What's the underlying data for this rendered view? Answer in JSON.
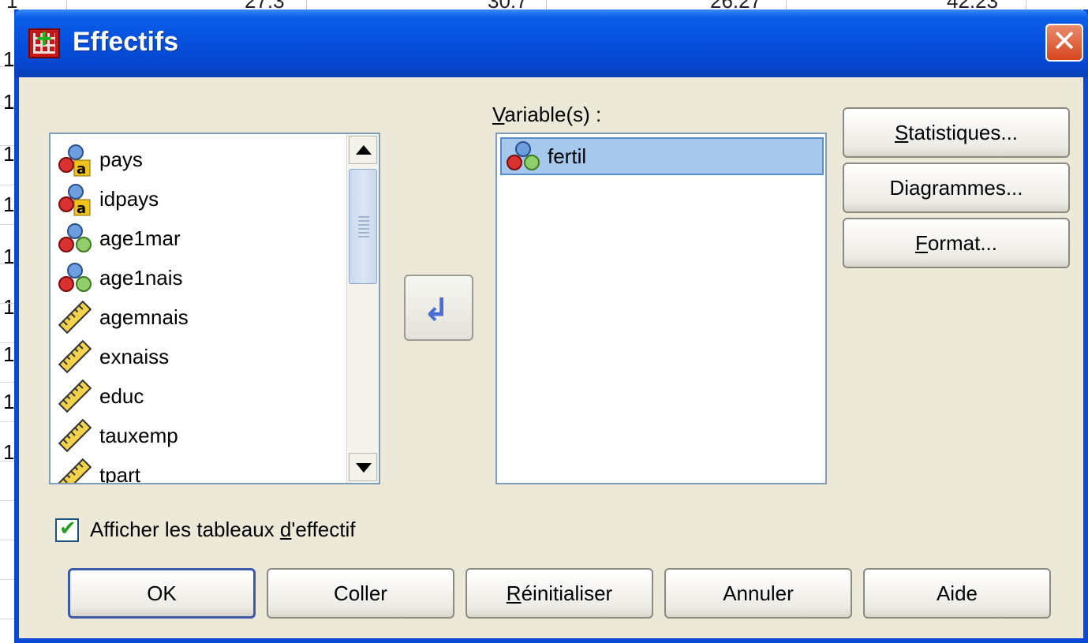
{
  "background": {
    "top_fragments": [
      "27.3",
      "30.7",
      "26.27",
      "42.23"
    ],
    "row_char": "1"
  },
  "dialog": {
    "title": "Effectifs",
    "close_glyph": "✕"
  },
  "source_list": {
    "items": [
      {
        "label": "pays",
        "icon": "nominal-string-icon"
      },
      {
        "label": "idpays",
        "icon": "nominal-string-icon"
      },
      {
        "label": "age1mar",
        "icon": "nominal-numeric-icon"
      },
      {
        "label": "age1nais",
        "icon": "nominal-numeric-icon"
      },
      {
        "label": "agemnais",
        "icon": "scale-ruler-icon"
      },
      {
        "label": "exnaiss",
        "icon": "scale-ruler-icon"
      },
      {
        "label": "educ",
        "icon": "scale-ruler-icon"
      },
      {
        "label": "tauxemp",
        "icon": "scale-ruler-icon"
      },
      {
        "label": "tpart",
        "icon": "scale-ruler-icon"
      }
    ]
  },
  "target": {
    "label_prefix": "V",
    "label_rest": "ariable(s) :",
    "items": [
      {
        "label": "fertil",
        "icon": "nominal-numeric-icon"
      }
    ]
  },
  "move_button": {
    "icon": "move-left-arrow-icon",
    "glyph": "↲"
  },
  "side_buttons": {
    "statistiques": {
      "mnemonic": "S",
      "rest": "tatistiques..."
    },
    "diagrammes": {
      "label": "Diagrammes..."
    },
    "format": {
      "mnemonic": "F",
      "rest": "ormat..."
    }
  },
  "checkbox": {
    "checked": true,
    "label_before": "Afficher les tableaux ",
    "mnemonic": "d",
    "label_after": "'effectif"
  },
  "bottom_buttons": {
    "ok": "OK",
    "coller": "Coller",
    "reinit_mnemonic": "R",
    "reinit_rest": "éinitialiser",
    "annuler": "Annuler",
    "aide": "Aide"
  },
  "colors": {
    "title_bar": "#0751de",
    "dialog_bg": "#ece9d8",
    "selection": "#a6c8ec",
    "close_button": "#d6451e"
  }
}
